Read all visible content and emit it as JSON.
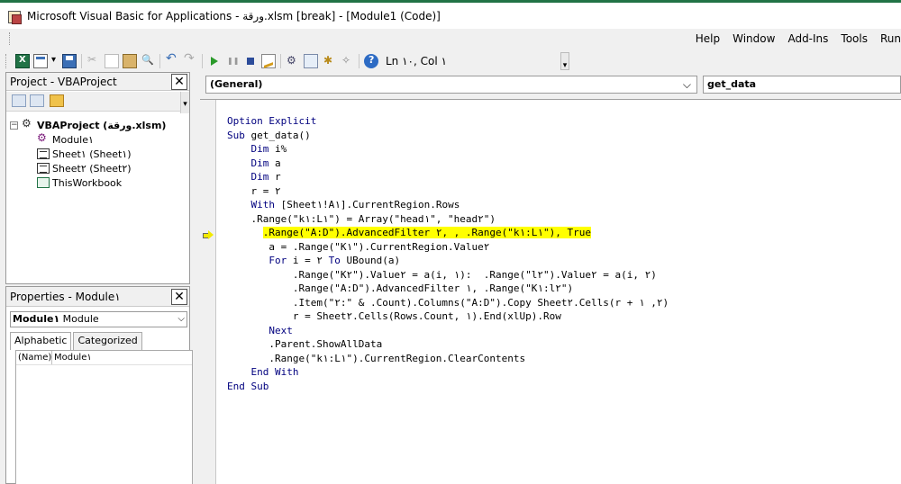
{
  "window": {
    "title": "Microsoft Visual Basic for Applications - ورقة.xlsm [break] - [Module1 (Code)]"
  },
  "menu": {
    "items": [
      {
        "label": "Help"
      },
      {
        "label": "Window"
      },
      {
        "label": "Add-Ins"
      },
      {
        "label": "Tools"
      },
      {
        "label": "Run"
      }
    ]
  },
  "toolbar": {
    "status": "Ln ١٠, Col ١"
  },
  "project_explorer": {
    "title": "Project - VBAProject",
    "tree": {
      "root": "VBAProject (ورقة.xlsm)",
      "children": [
        "Module١",
        "Sheet١ (Sheet١)",
        "Sheet٢ (Sheet٢)",
        "ThisWorkbook"
      ]
    }
  },
  "properties": {
    "title": "Properties - Module١",
    "object_name": "Module١",
    "object_type": "Module",
    "tabs": [
      "Alphabetic",
      "Categorized"
    ],
    "rows": [
      {
        "key": "(Name)",
        "value": "Module١"
      }
    ]
  },
  "code": {
    "object_combo": "(General)",
    "proc_combo": "get_data",
    "lines": [
      "Option Explicit",
      "Sub get_data()",
      "    Dim i%",
      "    Dim a",
      "    Dim r",
      "    r = ٢",
      "    With [Sheet١!A١].CurrentRegion.Rows",
      "    .Range(\"k١:L١\") = Array(\"head١\", \"head٢\")",
      "      .Range(\"A:D\").AdvancedFilter ٢, , .Range(\"k١:L١\"), True",
      "       a = .Range(\"K١\").CurrentRegion.Value٢",
      "       For i = ٢ To UBound(a)",
      "           .Range(\"K٢\").Value٢ = a(i, ١):  .Range(\"l٢\").Value٢ = a(i, ٢)",
      "           .Range(\"A:D\").AdvancedFilter ١, .Range(\"K١:l٢\")",
      "           .Item(\"٢:\" & .Count).Columns(\"A:D\").Copy Sheet٢.Cells(r + ٢, ١)",
      "           r = Sheet٢.Cells(Rows.Count, ١).End(xlUp).Row",
      "       Next",
      "       .Parent.ShowAllData",
      "       .Range(\"k١:L١\").CurrentRegion.ClearContents",
      "    End With",
      "End Sub"
    ],
    "highlight_line_index": 8
  }
}
